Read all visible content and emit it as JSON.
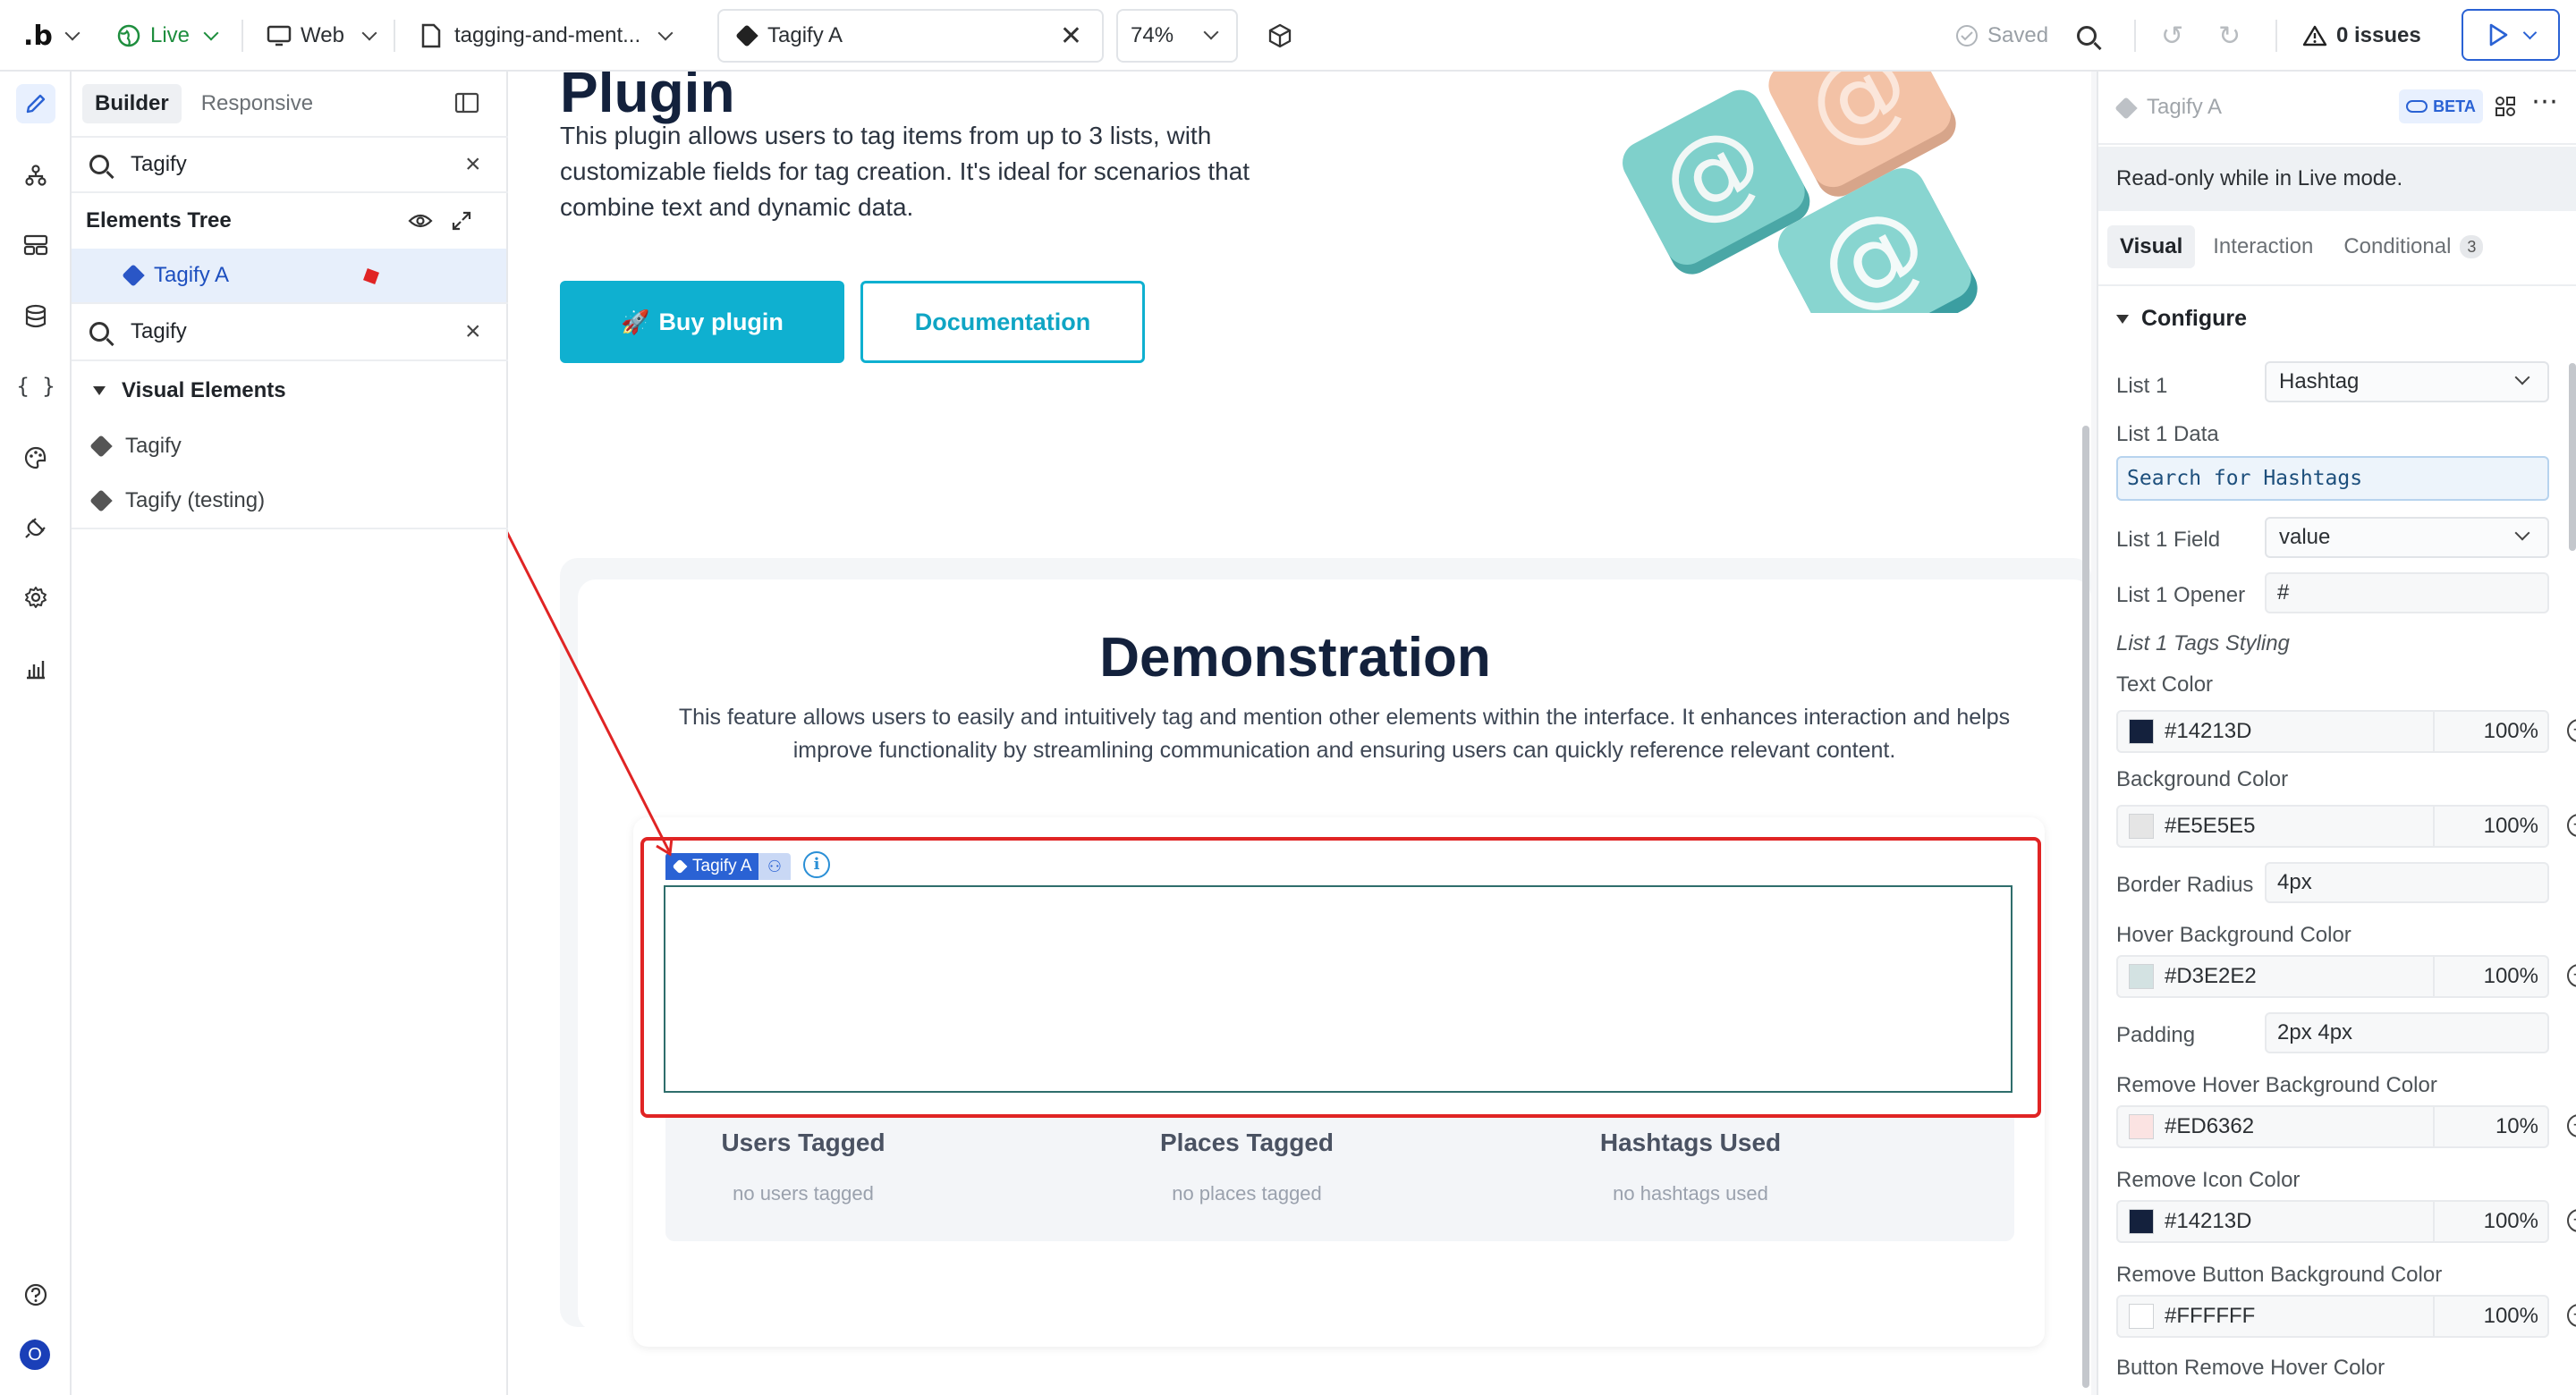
{
  "topbar": {
    "logo": ".b",
    "env": "Live",
    "device": "Web",
    "page": "tagging-and-ment...",
    "element": "Tagify A",
    "zoom": "74%",
    "saved": "Saved",
    "issues": "0 issues"
  },
  "rail": {
    "items": [
      "edit",
      "tree",
      "layout",
      "data",
      "code",
      "styles",
      "plugins",
      "settings",
      "analytics"
    ],
    "bottom_avatar": "O"
  },
  "left_panel": {
    "tabs": [
      "Builder",
      "Responsive"
    ],
    "search1_value": "Tagify",
    "tree_title": "Elements Tree",
    "tree_item": "Tagify A",
    "search2_value": "Tagify",
    "section": "Visual Elements",
    "items": [
      "Tagify",
      "Tagify (testing)"
    ]
  },
  "canvas": {
    "hero_title": "Plugin",
    "hero_text": "This plugin allows users to tag items from up to 3 lists, with customizable fields for tag creation. It's ideal for scenarios that combine text and dynamic data.",
    "buy_button": "Buy plugin",
    "doc_button": "Documentation",
    "demo_title": "Demonstration",
    "demo_desc": "This feature allows users to easily and intuitively tag and mention other elements within the interface. It enhances interaction and helps improve functionality by streamlining communication and ensuring users can quickly reference relevant content.",
    "element_label": "Tagify A",
    "stats": [
      {
        "title": "Users Tagged",
        "value": "no users tagged"
      },
      {
        "title": "Places Tagged",
        "value": "no places tagged"
      },
      {
        "title": "Hashtags Used",
        "value": "no hashtags used"
      }
    ]
  },
  "right_panel": {
    "element_name": "Tagify A",
    "beta": "BETA",
    "notice": "Read-only while in Live mode.",
    "tabs": [
      "Visual",
      "Interaction",
      "Conditional"
    ],
    "conditional_count": "3",
    "section": "Configure",
    "list1_label": "List 1",
    "list1_value": "Hashtag",
    "list1_data_label": "List 1 Data",
    "list1_data_value": "Search for Hashtags",
    "list1_field_label": "List 1 Field",
    "list1_field_value": "value",
    "list1_opener_label": "List 1 Opener",
    "list1_opener_value": "#",
    "styling_label": "List 1 Tags Styling",
    "text_color_label": "Text Color",
    "text_color": {
      "hex": "#14213D",
      "pct": "100%"
    },
    "bg_color_label": "Background Color",
    "bg_color": {
      "hex": "#E5E5E5",
      "pct": "100%"
    },
    "border_radius_label": "Border Radius",
    "border_radius_value": "4px",
    "hover_bg_label": "Hover Background Color",
    "hover_bg": {
      "hex": "#D3E2E2",
      "pct": "100%"
    },
    "padding_label": "Padding",
    "padding_value": "2px 4px",
    "remove_hover_label": "Remove Hover Background Color",
    "remove_hover": {
      "hex": "#ED6362",
      "pct": "10%"
    },
    "remove_icon_label": "Remove Icon Color",
    "remove_icon": {
      "hex": "#14213D",
      "pct": "100%"
    },
    "remove_btn_bg_label": "Remove Button Background Color",
    "remove_btn_bg": {
      "hex": "#FFFFFF",
      "pct": "100%"
    },
    "button_remove_hover_label": "Button Remove Hover Color"
  },
  "colors": {
    "accent": "#2A62D4",
    "cyan": "#0FB0D0",
    "selection": "#E02424",
    "navy": "#14213D"
  }
}
